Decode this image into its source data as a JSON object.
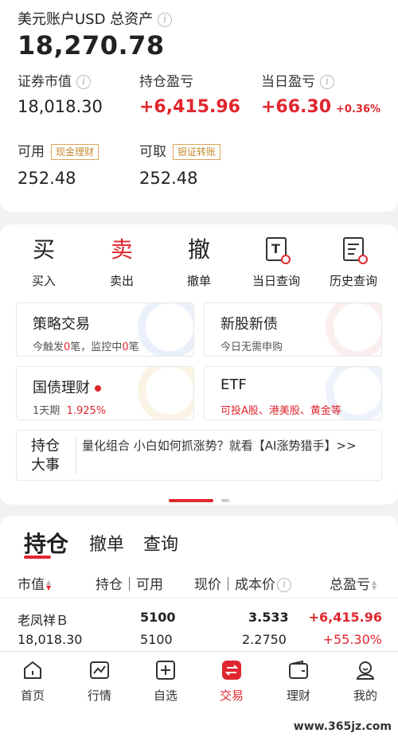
{
  "account": {
    "title": "美元账户USD 总资产",
    "total": "18,270.78",
    "market_value_label": "证券市值",
    "market_value": "18,018.30",
    "position_pnl_label": "持仓盈亏",
    "position_pnl": "+6,415.96",
    "daily_pnl_label": "当日盈亏",
    "daily_pnl": "+66.30",
    "daily_pnl_pct": "+0.36%",
    "available_label": "可用",
    "available_tag": "现金理财",
    "available": "252.48",
    "withdrawable_label": "可取",
    "withdrawable_tag": "银证转账",
    "withdrawable": "252.48"
  },
  "actions": [
    {
      "glyph": "买",
      "label": "买入"
    },
    {
      "glyph": "卖",
      "label": "卖出"
    },
    {
      "glyph": "撤",
      "label": "撤单"
    },
    {
      "glyph": "T",
      "label": "当日查询"
    },
    {
      "glyph": "",
      "label": "历史查询"
    }
  ],
  "features": {
    "strategy": {
      "title": "策略交易",
      "sub_prefix": "今触发",
      "sub_count1": "0",
      "sub_mid": "笔，监控中",
      "sub_count2": "0",
      "sub_suffix": "笔"
    },
    "ipo": {
      "title": "新股新债",
      "sub": "今日无需申购"
    },
    "bond": {
      "title": "国债理财",
      "sub_term": "1天期",
      "sub_rate": "1.925%"
    },
    "etf": {
      "title": "ETF",
      "sub": "可投A股、港美股、黄金等"
    }
  },
  "news": {
    "head": "持仓大事",
    "text": "量化组合 小白如何抓涨势？就看【AI涨势猎手】>>"
  },
  "holdings": {
    "tabs": [
      "持仓",
      "撤单",
      "查询"
    ],
    "columns": {
      "col1": "市值",
      "col2": "持仓｜可用",
      "col3": "现价｜成本价",
      "col4": "总盈亏"
    },
    "rows": [
      {
        "name": "老凤祥Ｂ",
        "market_value": "18,018.30",
        "position": "5100",
        "available": "5100",
        "price": "3.533",
        "cost": "2.2750",
        "pnl": "+6,415.96",
        "pnl_pct": "+55.30%"
      }
    ]
  },
  "nav": [
    {
      "label": "首页",
      "icon": "home-icon"
    },
    {
      "label": "行情",
      "icon": "chart-icon"
    },
    {
      "label": "自选",
      "icon": "plus-box-icon"
    },
    {
      "label": "交易",
      "icon": "trade-icon"
    },
    {
      "label": "理财",
      "icon": "wallet-icon"
    },
    {
      "label": "我的",
      "icon": "user-icon"
    }
  ],
  "watermark": "www.365jz.com",
  "colors": {
    "accent": "#e0262d",
    "tag": "#c58a30"
  }
}
